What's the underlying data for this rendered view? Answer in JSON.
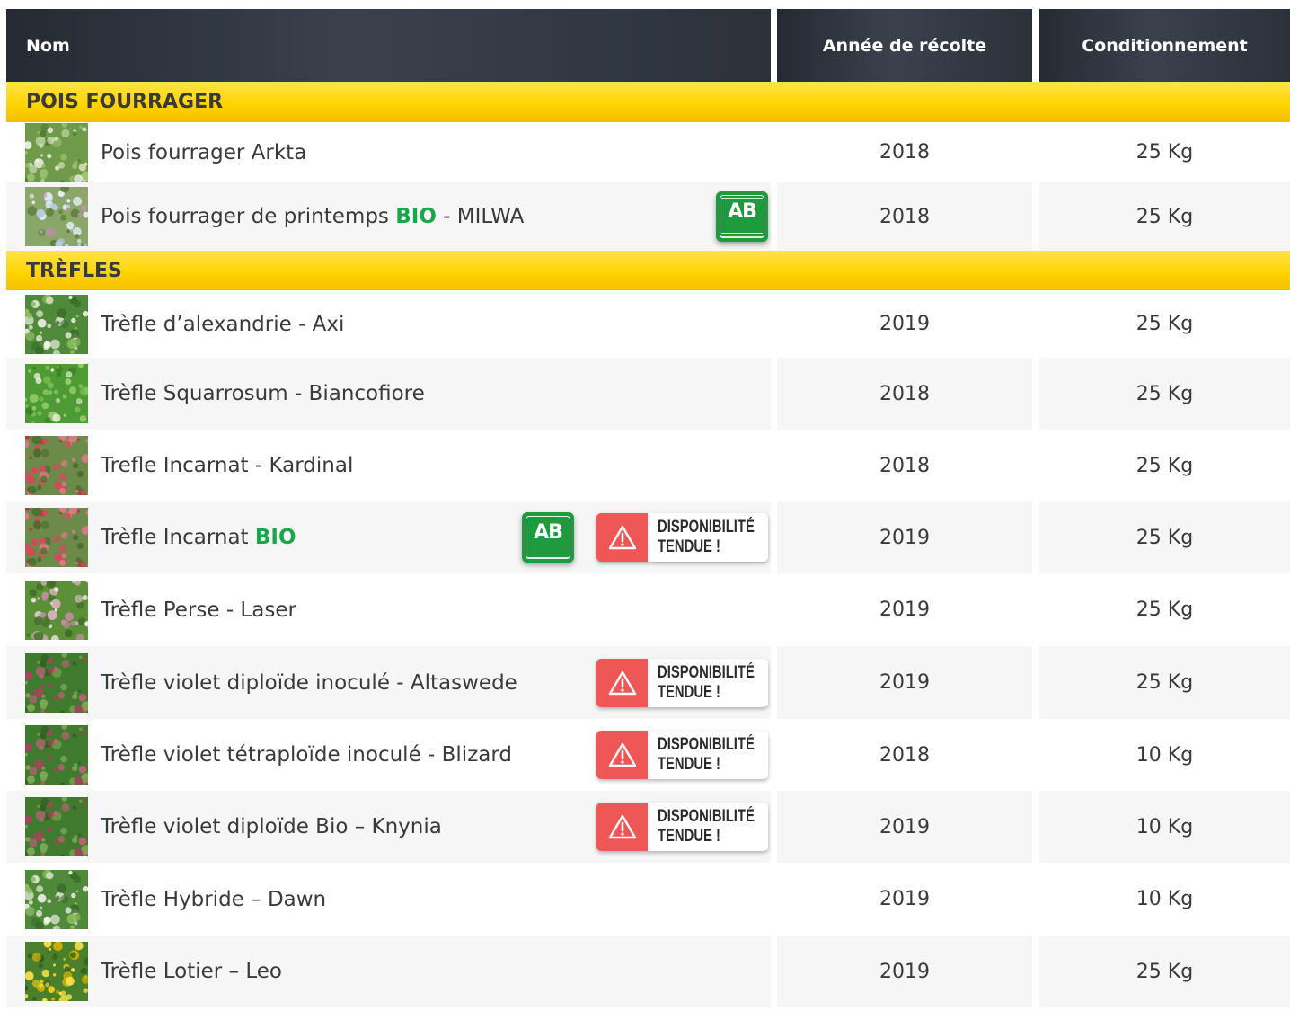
{
  "header": {
    "name": "Nom",
    "year": "Année de récolte",
    "pack": "Conditionnement"
  },
  "badges": {
    "warning_line1": "DISPONIBILITÉ",
    "warning_line2": "TENDUE !",
    "ab_mark": "AB",
    "bio_word": "BIO"
  },
  "colors": {
    "header_bg": "#2c313a",
    "category_bg": "#ffd500",
    "bio_green": "#1aa64b",
    "ab_green": "#1f9a3e",
    "warning_red": "#ef5656"
  },
  "sections": [
    {
      "title": "POIS FOURRAGER",
      "rows": [
        {
          "name": "Pois fourrager Arkta",
          "year": "2018",
          "pack": "25 Kg",
          "thumb": "thumb-green-flowers",
          "ab": false,
          "warning": false
        },
        {
          "name_pre": "Pois fourrager de printemps ",
          "name_post": " - MILWA",
          "year": "2018",
          "pack": "25 Kg",
          "thumb": "thumb-field",
          "ab": true,
          "warning": false
        }
      ]
    },
    {
      "title": "TRÈFLES",
      "rows": [
        {
          "name": "Trèfle d’alexandrie - Axi",
          "year": "2019",
          "pack": "25 Kg",
          "thumb": "thumb-white-clover",
          "ab": false,
          "warning": false
        },
        {
          "name": "Trèfle Squarrosum - Biancofiore",
          "year": "2018",
          "pack": "25 Kg",
          "thumb": "thumb-leaves",
          "ab": false,
          "warning": false
        },
        {
          "name": "Trefle Incarnat - Kardinal",
          "year": "2018",
          "pack": "25 Kg",
          "thumb": "thumb-red-clover",
          "ab": false,
          "warning": false
        },
        {
          "name_pre": "Trèfle Incarnat ",
          "name_post": "",
          "year": "2019",
          "pack": "25 Kg",
          "thumb": "thumb-red-clover",
          "ab": true,
          "warning": true
        },
        {
          "name": "Trèfle Perse - Laser",
          "year": "2019",
          "pack": "25 Kg",
          "thumb": "thumb-pink-clover",
          "ab": false,
          "warning": false
        },
        {
          "name": "Trèfle violet diploïde inoculé - Altaswede",
          "year": "2019",
          "pack": "25 Kg",
          "thumb": "thumb-violet-clover",
          "ab": false,
          "warning": true
        },
        {
          "name": "Trèfle violet tétraploïde inoculé - Blizard",
          "year": "2018",
          "pack": "10 Kg",
          "thumb": "thumb-violet-clover",
          "ab": false,
          "warning": true
        },
        {
          "name": "Trèfle violet diploïde Bio – Knynia",
          "year": "2019",
          "pack": "10 Kg",
          "thumb": "thumb-violet-clover",
          "ab": false,
          "warning": true
        },
        {
          "name": "Trèfle Hybride – Dawn",
          "year": "2019",
          "pack": "10 Kg",
          "thumb": "thumb-white-clover",
          "ab": false,
          "warning": false
        },
        {
          "name": "Trèfle Lotier – Leo",
          "year": "2019",
          "pack": "25 Kg",
          "thumb": "thumb-yellow-flowers",
          "ab": false,
          "warning": false
        }
      ]
    }
  ]
}
